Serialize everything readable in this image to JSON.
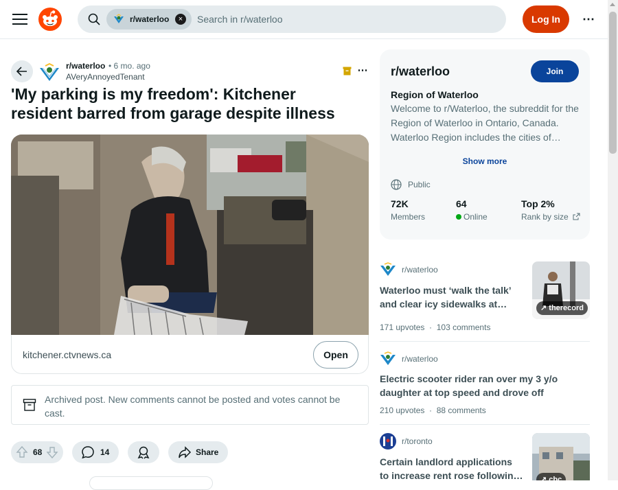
{
  "header": {
    "search_chip": "r/waterloo",
    "search_chip_close": "×",
    "search_placeholder": "Search in r/waterloo",
    "login_label": "Log In",
    "more_label": "⋯"
  },
  "post": {
    "subreddit": "r/waterloo",
    "age": "• 6 mo. ago",
    "author": "AVeryAnnoyedTenant",
    "more_label": "⋯",
    "title": "'My parking is my freedom': Kitchener resident barred from garage despite illness",
    "link_domain": "kitchener.ctvnews.ca",
    "open_label": "Open",
    "archived_notice": "Archived post. New comments cannot be posted and votes cannot be cast.",
    "votes": "68",
    "comments": "14",
    "share_label": "Share"
  },
  "sidebar": {
    "name": "r/waterloo",
    "join_label": "Join",
    "heading": "Region of Waterloo",
    "description": "Welcome to r/Waterloo, the subreddit for the Region of Waterloo in Ontario, Canada. Waterloo Region includes the cities of…",
    "show_more": "Show more",
    "visibility": "Public",
    "stats": [
      {
        "value": "72K",
        "label": "Members"
      },
      {
        "value": "64",
        "label": "Online"
      },
      {
        "value": "Top 2%",
        "label": "Rank by size"
      }
    ]
  },
  "related": [
    {
      "subreddit": "r/waterloo",
      "title": "Waterloo must ‘walk the talk’ and clear icy sidewalks at…",
      "upvotes": "171 upvotes",
      "comments": "103 comments",
      "thumb_label": "therecord"
    },
    {
      "subreddit": "r/waterloo",
      "title": "Electric scooter rider ran over my 3 y/o daughter at top speed and drove off",
      "upvotes": "210 upvotes",
      "comments": "88 comments"
    },
    {
      "subreddit": "r/toronto",
      "title": "Certain landlord applications to increase rent rose followin…",
      "thumb_label": "cbc"
    }
  ],
  "colors": {
    "brand": "#ff4500",
    "login": "#d93900",
    "join": "#0a449b",
    "online": "#01a816"
  }
}
